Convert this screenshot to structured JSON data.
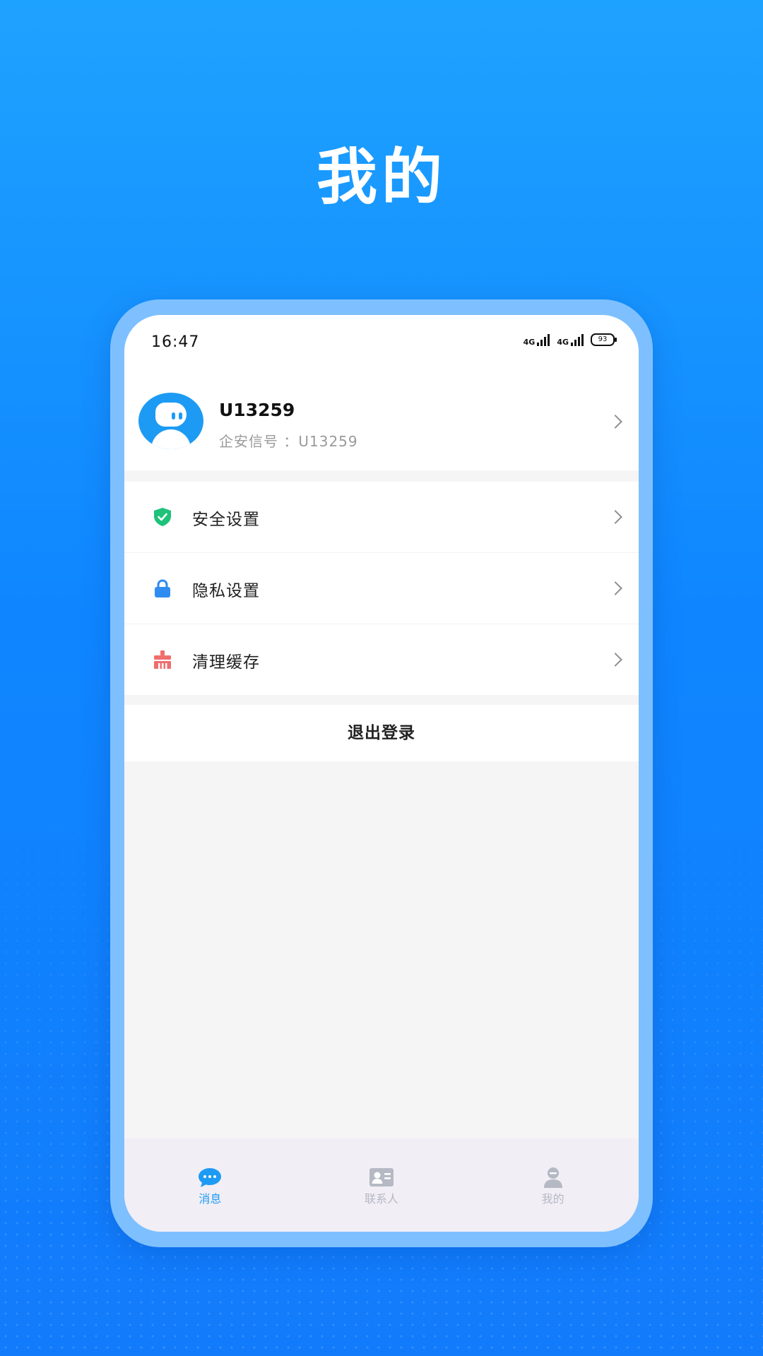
{
  "promo": {
    "title": "我的"
  },
  "status_bar": {
    "time": "16:47",
    "sig1_label": "4G",
    "sig2_label": "4G",
    "battery": "93"
  },
  "profile": {
    "name": "U13259",
    "id_label": "企安信号 ：U13259"
  },
  "menu": {
    "items": [
      {
        "label": "安全设置",
        "icon": "shield-check-icon",
        "color": "#1ec27a"
      },
      {
        "label": "隐私设置",
        "icon": "lock-icon",
        "color": "#2f8cf0"
      },
      {
        "label": "清理缓存",
        "icon": "broom-icon",
        "color": "#f06e6e"
      }
    ]
  },
  "logout": {
    "label": "退出登录"
  },
  "tabs": [
    {
      "label": "消息",
      "icon": "chat-bubble-icon",
      "active": true
    },
    {
      "label": "联系人",
      "icon": "contact-card-icon",
      "active": false
    },
    {
      "label": "我的",
      "icon": "person-icon",
      "active": false
    }
  ],
  "colors": {
    "accent": "#1d9bf4",
    "background": "#0f86ff",
    "frame": "#7ec0ff",
    "tab_inactive": "#b5b9c4"
  }
}
